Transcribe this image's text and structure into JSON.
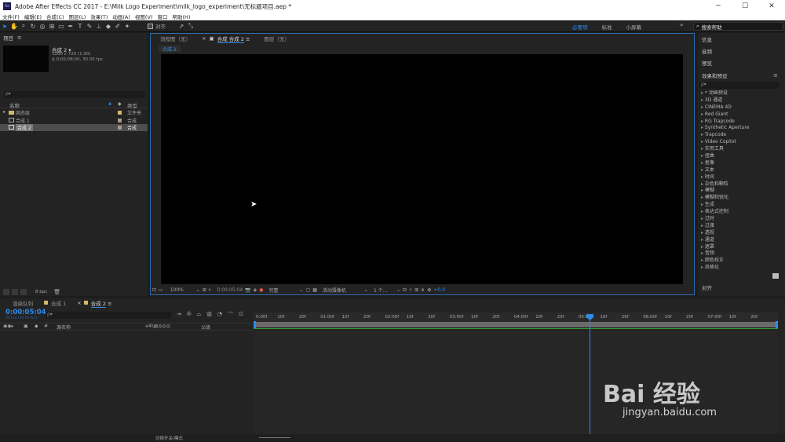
{
  "app": {
    "title": "Adobe After Effects CC 2017 - E:\\Milk Logo Experiment\\milk_logo_experiment\\无标题项目.aep *",
    "logo": "Ae"
  },
  "menu": [
    "文件(F)",
    "编辑(E)",
    "合成(C)",
    "图层(L)",
    "效果(T)",
    "动画(A)",
    "视图(V)",
    "窗口",
    "帮助(H)"
  ],
  "toolbar": {
    "align_label": "对齐",
    "workspaces": [
      "必要项",
      "标准",
      "小屏幕"
    ],
    "search_help": "搜索帮助"
  },
  "project": {
    "title": "项目",
    "comp_name": "合成 2 ▾",
    "comp_size": "1280 x 720 (1.00)",
    "comp_duration": "Δ 0;00;08;00, 30.00 fps",
    "search_placeholder": "ρ▾",
    "col_name": "名称",
    "col_type": "类型",
    "items": [
      {
        "name": "固态层",
        "type": "文件夹"
      },
      {
        "name": "合成 1",
        "type": "合成"
      },
      {
        "name": "合成 2",
        "type": "合成"
      }
    ],
    "bpc": "8 bpc"
  },
  "viewer": {
    "tabs": [
      "流程图（无）",
      "合成 合成 2",
      "图层（无）"
    ],
    "breadcrumb": "合成 2",
    "zoom": "100%",
    "timecode": "0:00:05:04",
    "quality": "完整",
    "camera": "活动摄像机",
    "views": "1 个...",
    "exposure": "+0.0"
  },
  "right_panels": {
    "info": "信息",
    "audio": "音频",
    "preview": "预览",
    "effects": "效果和预设",
    "align": "对齐",
    "effects_list": [
      "* 动画预设",
      "3D 通道",
      "CINEMA 4D",
      "Red Giant",
      "RG Trapcode",
      "Synthetic Aperture",
      "Trapcode",
      "Video Copilot",
      "实用工具",
      "扭曲",
      "抠像",
      "文本",
      "时间",
      "杂色和颗粒",
      "模糊",
      "模糊和锐化",
      "生成",
      "表达式控制",
      "过时",
      "过渡",
      "透视",
      "通道",
      "遮罩",
      "音频",
      "颜色校正",
      "风格化"
    ]
  },
  "timeline": {
    "tabs": [
      "渲染队列",
      "合成 1",
      "合成 2"
    ],
    "timecode": "0:00:05:04",
    "frame_info": "00154 (30.00 fps)",
    "col_source": "源名称",
    "col_parent": "父级",
    "footer": "切换开关/模式",
    "ticks": [
      "0:00f",
      "10f",
      "20f",
      "01:00f",
      "10f",
      "20f",
      "02:00f",
      "10f",
      "20f",
      "03:00f",
      "10f",
      "20f",
      "04:00f",
      "10f",
      "20f",
      "05:00f",
      "10f",
      "20f",
      "06:00f",
      "10f",
      "20f",
      "07:00f",
      "10f",
      "20f"
    ]
  },
  "watermark": {
    "brand": "Bai 经验",
    "url": "jingyan.baidu.com"
  }
}
